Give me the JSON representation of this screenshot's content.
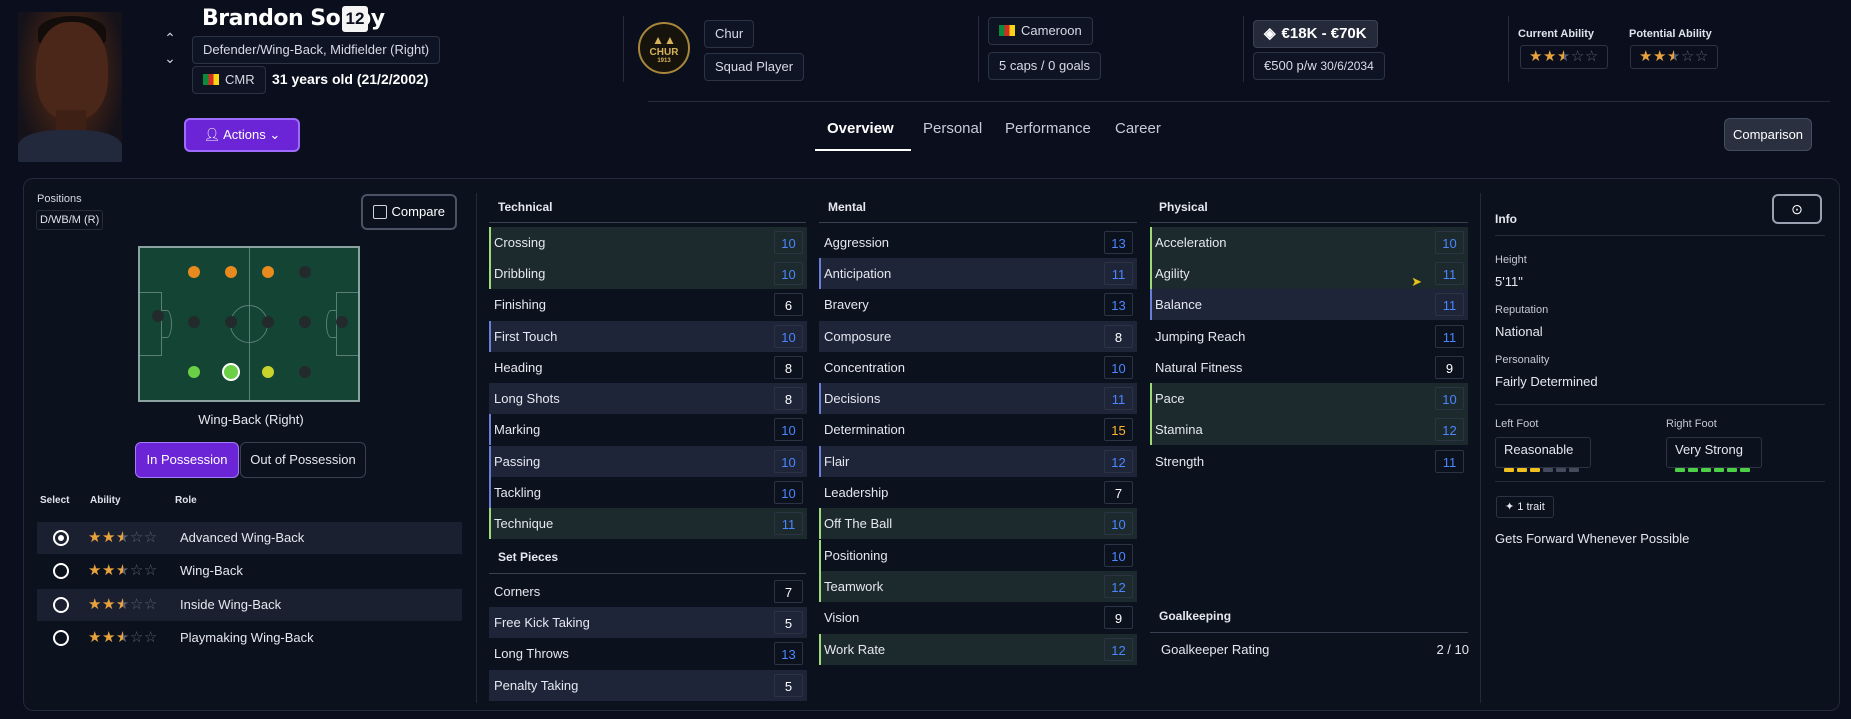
{
  "player": {
    "name": "Brandon Soppy",
    "number": "12",
    "positions_full": "Defender/Wing-Back, Midfielder (Right)",
    "nationality_code": "CMR",
    "age_text": "31 years old (21/2/2002)"
  },
  "club": {
    "name": "Chur",
    "status": "Squad Player",
    "badge_main": "CHUR",
    "badge_year": "1913"
  },
  "nation": {
    "name": "Cameroon",
    "caps_text": "5 caps / 0 goals"
  },
  "contract": {
    "value_range": "€18K - €70K",
    "wage": "€500 p/w",
    "expiry": "30/6/2034"
  },
  "ability": {
    "current_label": "Current Ability",
    "potential_label": "Potential Ability",
    "current_stars": 2.5,
    "potential_stars": 2.5
  },
  "actions_label": "Actions",
  "tabs": [
    {
      "label": "Overview",
      "active": true
    },
    {
      "label": "Personal",
      "active": false
    },
    {
      "label": "Performance",
      "active": false
    },
    {
      "label": "Career",
      "active": false
    }
  ],
  "comparison_label": "Comparison",
  "positions_panel": {
    "label": "Positions",
    "short": "D/WB/M (R)",
    "compare_label": "Compare",
    "selected_position": "Wing-Back (Right)",
    "toggle_in": "In Possession",
    "toggle_out": "Out of Possession",
    "headers": {
      "select": "Select",
      "ability": "Ability",
      "role": "Role"
    },
    "roles": [
      {
        "name": "Advanced Wing-Back",
        "stars": 2.5,
        "selected": true
      },
      {
        "name": "Wing-Back",
        "stars": 2.5,
        "selected": false
      },
      {
        "name": "Inside Wing-Back",
        "stars": 2.5,
        "selected": false
      },
      {
        "name": "Playmaking Wing-Back",
        "stars": 2.5,
        "selected": false
      }
    ]
  },
  "technical": {
    "title": "Technical",
    "attrs": [
      {
        "name": "Crossing",
        "value": "10"
      },
      {
        "name": "Dribbling",
        "value": "10"
      },
      {
        "name": "Finishing",
        "value": "6"
      },
      {
        "name": "First Touch",
        "value": "10"
      },
      {
        "name": "Heading",
        "value": "8"
      },
      {
        "name": "Long Shots",
        "value": "8"
      },
      {
        "name": "Marking",
        "value": "10"
      },
      {
        "name": "Passing",
        "value": "10"
      },
      {
        "name": "Tackling",
        "value": "10"
      },
      {
        "name": "Technique",
        "value": "11"
      }
    ]
  },
  "set_pieces": {
    "title": "Set Pieces",
    "attrs": [
      {
        "name": "Corners",
        "value": "7"
      },
      {
        "name": "Free Kick Taking",
        "value": "5"
      },
      {
        "name": "Long Throws",
        "value": "13"
      },
      {
        "name": "Penalty Taking",
        "value": "5"
      }
    ]
  },
  "mental": {
    "title": "Mental",
    "attrs": [
      {
        "name": "Aggression",
        "value": "13"
      },
      {
        "name": "Anticipation",
        "value": "11"
      },
      {
        "name": "Bravery",
        "value": "13"
      },
      {
        "name": "Composure",
        "value": "8"
      },
      {
        "name": "Concentration",
        "value": "10"
      },
      {
        "name": "Decisions",
        "value": "11"
      },
      {
        "name": "Determination",
        "value": "15"
      },
      {
        "name": "Flair",
        "value": "12"
      },
      {
        "name": "Leadership",
        "value": "7"
      },
      {
        "name": "Off The Ball",
        "value": "10"
      },
      {
        "name": "Positioning",
        "value": "10"
      },
      {
        "name": "Teamwork",
        "value": "12"
      },
      {
        "name": "Vision",
        "value": "9"
      },
      {
        "name": "Work Rate",
        "value": "12"
      }
    ]
  },
  "physical": {
    "title": "Physical",
    "attrs": [
      {
        "name": "Acceleration",
        "value": "10"
      },
      {
        "name": "Agility",
        "value": "11"
      },
      {
        "name": "Balance",
        "value": "11"
      },
      {
        "name": "Jumping Reach",
        "value": "11"
      },
      {
        "name": "Natural Fitness",
        "value": "9"
      },
      {
        "name": "Pace",
        "value": "10"
      },
      {
        "name": "Stamina",
        "value": "12"
      },
      {
        "name": "Strength",
        "value": "11"
      }
    ]
  },
  "goalkeeping": {
    "title": "Goalkeeping",
    "rating_label": "Goalkeeper Rating",
    "rating_value": "2 / 10"
  },
  "info": {
    "title": "Info",
    "height_label": "Height",
    "height": "5'11\"",
    "reputation_label": "Reputation",
    "reputation": "National",
    "personality_label": "Personality",
    "personality": "Fairly Determined",
    "left_foot_label": "Left Foot",
    "left_foot": "Reasonable",
    "left_foot_level": 3,
    "right_foot_label": "Right Foot",
    "right_foot": "Very Strong",
    "right_foot_level": 6,
    "traits_count": "1 trait",
    "trait": "Gets Forward Whenever Possible"
  },
  "colors": {
    "accent": "#6b24d6",
    "value_blue": "#4b86ff",
    "value_gold": "#ffb629",
    "star": "#e8a33d"
  }
}
